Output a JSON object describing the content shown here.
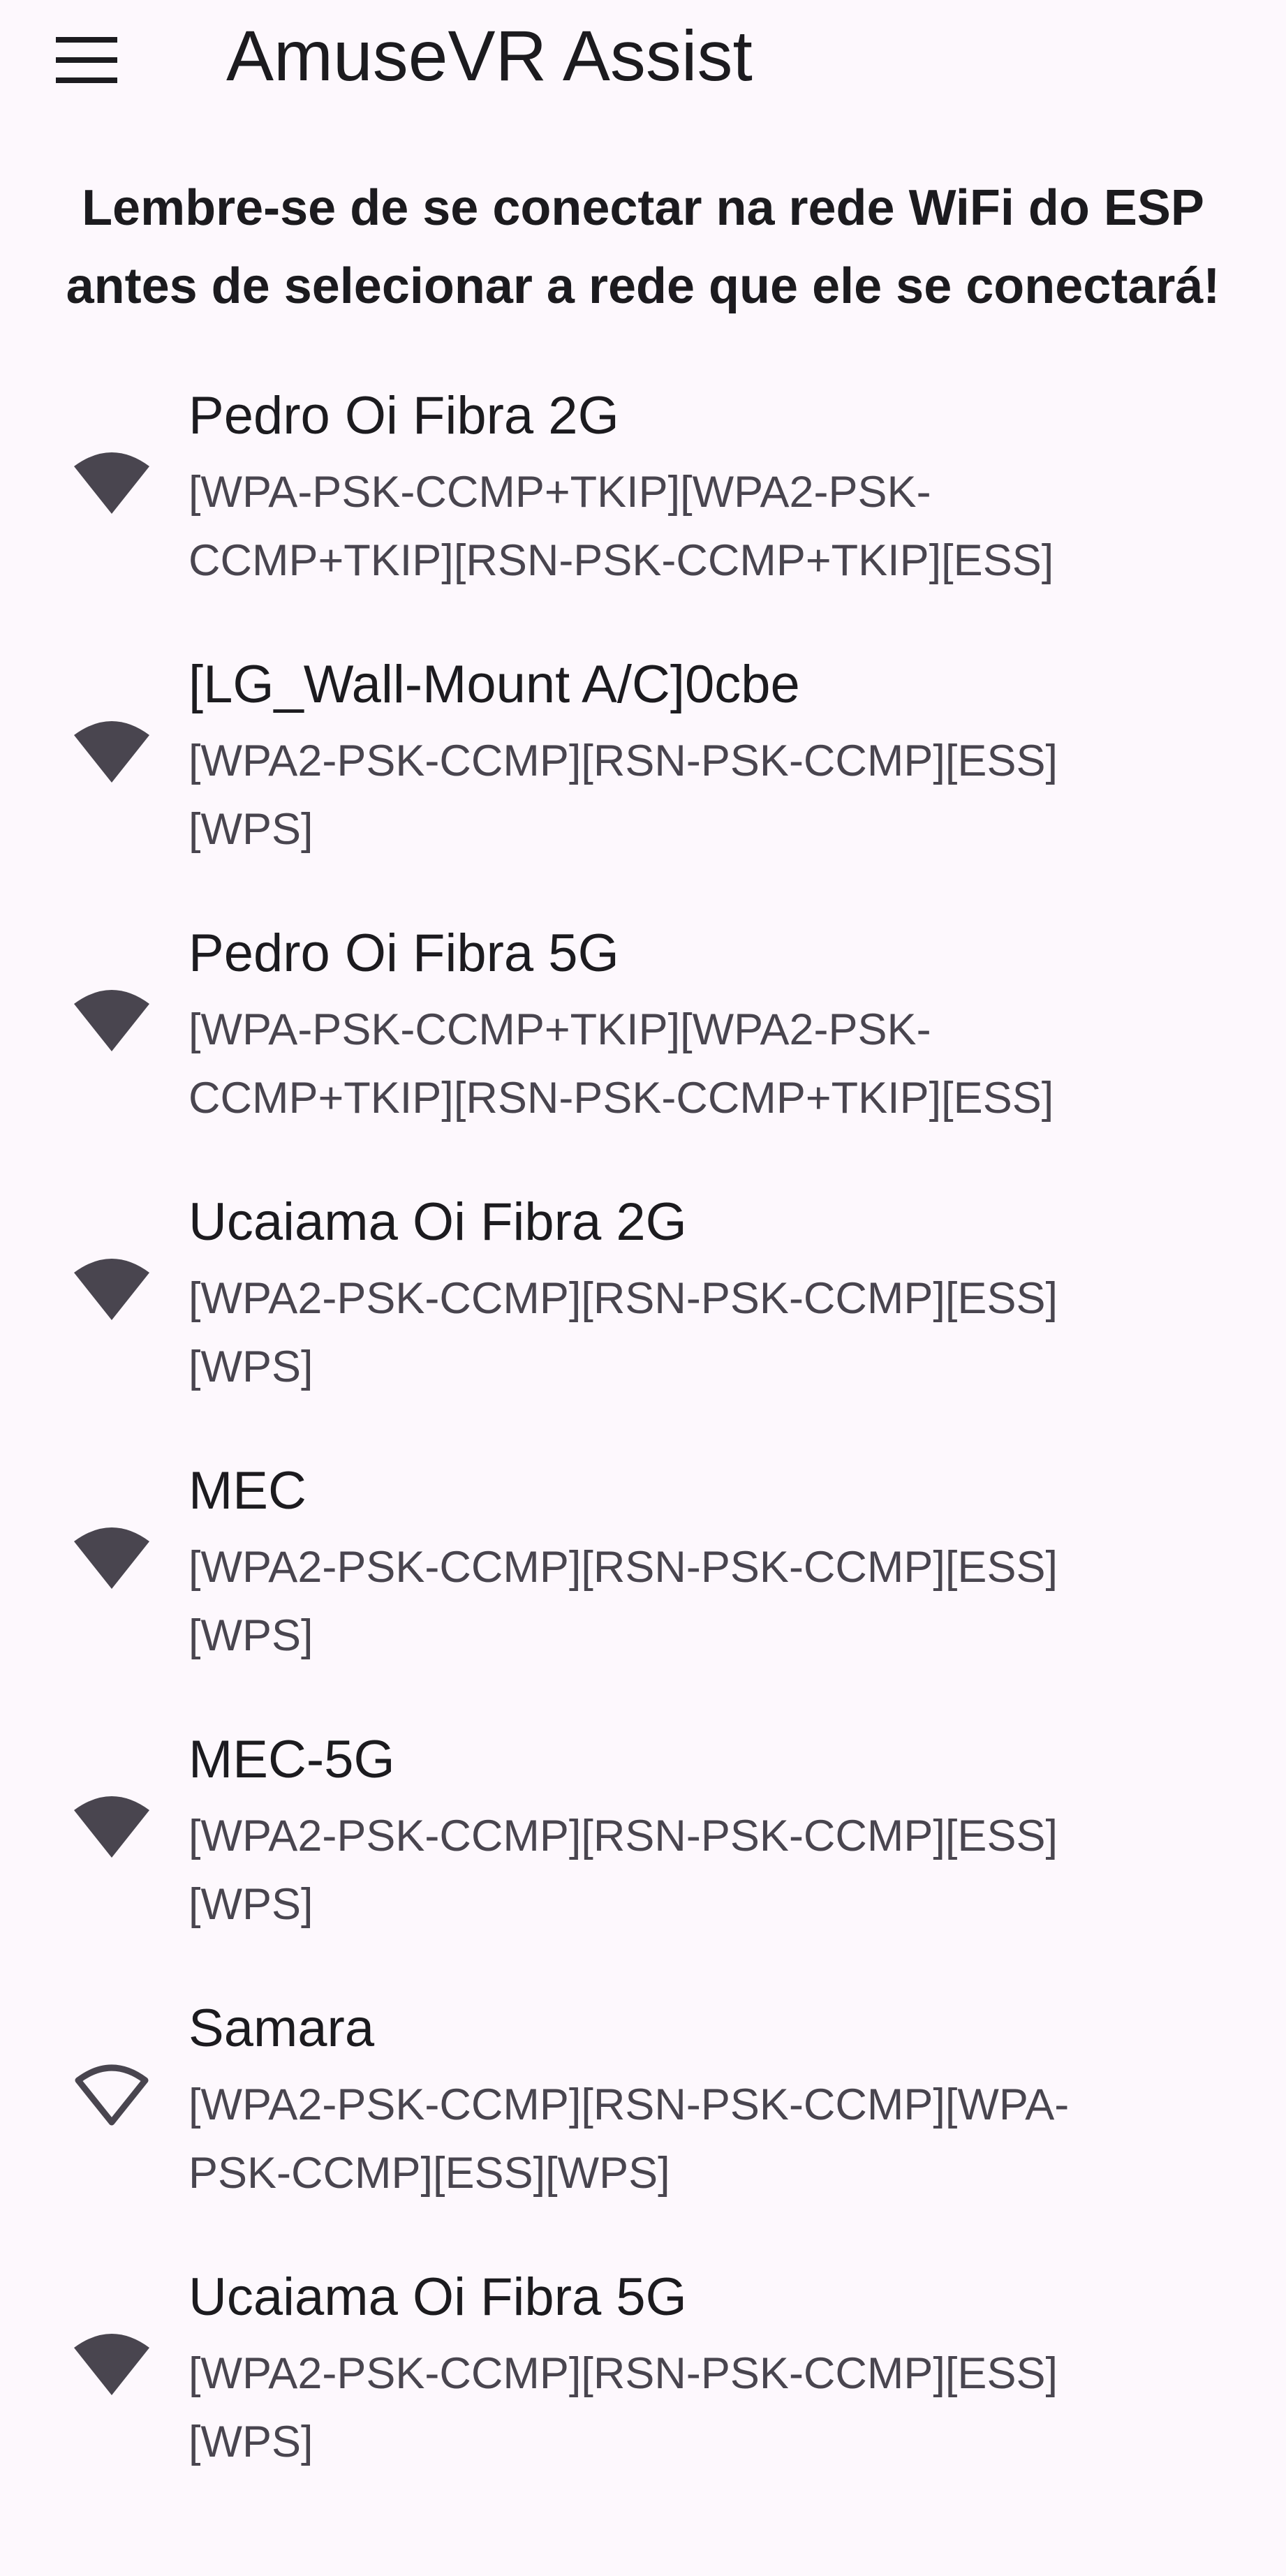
{
  "app": {
    "title": "AmuseVR Assist",
    "menu_icon": "menu-icon"
  },
  "notice": {
    "line1": "Lembre-se de se conectar na rede WiFi do ESP",
    "line2": "antes de selecionar a rede que ele se conectará!"
  },
  "colors": {
    "background": "#fdf8fd",
    "text_primary": "#1c1b1f",
    "text_secondary": "#49454f",
    "icon": "#49454f"
  },
  "networks": [
    {
      "ssid": "Pedro Oi Fibra 2G",
      "caps_line1": "[WPA-PSK-CCMP+TKIP][WPA2-PSK-",
      "caps_line2": "CCMP+TKIP][RSN-PSK-CCMP+TKIP][ESS]",
      "icon": "wifi-filled-icon"
    },
    {
      "ssid": "[LG_Wall-Mount A/C]0cbe",
      "caps_line1": "[WPA2-PSK-CCMP][RSN-PSK-CCMP][ESS]",
      "caps_line2": "[WPS]",
      "icon": "wifi-filled-icon"
    },
    {
      "ssid": "Pedro Oi Fibra 5G",
      "caps_line1": "[WPA-PSK-CCMP+TKIP][WPA2-PSK-",
      "caps_line2": "CCMP+TKIP][RSN-PSK-CCMP+TKIP][ESS]",
      "icon": "wifi-filled-icon"
    },
    {
      "ssid": "Ucaiama Oi Fibra 2G",
      "caps_line1": "[WPA2-PSK-CCMP][RSN-PSK-CCMP][ESS]",
      "caps_line2": "[WPS]",
      "icon": "wifi-filled-icon"
    },
    {
      "ssid": "MEC",
      "caps_line1": "[WPA2-PSK-CCMP][RSN-PSK-CCMP][ESS]",
      "caps_line2": "[WPS]",
      "icon": "wifi-filled-icon"
    },
    {
      "ssid": "MEC-5G",
      "caps_line1": "[WPA2-PSK-CCMP][RSN-PSK-CCMP][ESS]",
      "caps_line2": "[WPS]",
      "icon": "wifi-filled-icon"
    },
    {
      "ssid": "Samara",
      "caps_line1": "[WPA2-PSK-CCMP][RSN-PSK-CCMP][WPA-",
      "caps_line2": "PSK-CCMP][ESS][WPS]",
      "icon": "wifi-outline-icon"
    },
    {
      "ssid": "Ucaiama Oi Fibra 5G",
      "caps_line1": "[WPA2-PSK-CCMP][RSN-PSK-CCMP][ESS]",
      "caps_line2": "[WPS]",
      "icon": "wifi-filled-icon"
    }
  ]
}
